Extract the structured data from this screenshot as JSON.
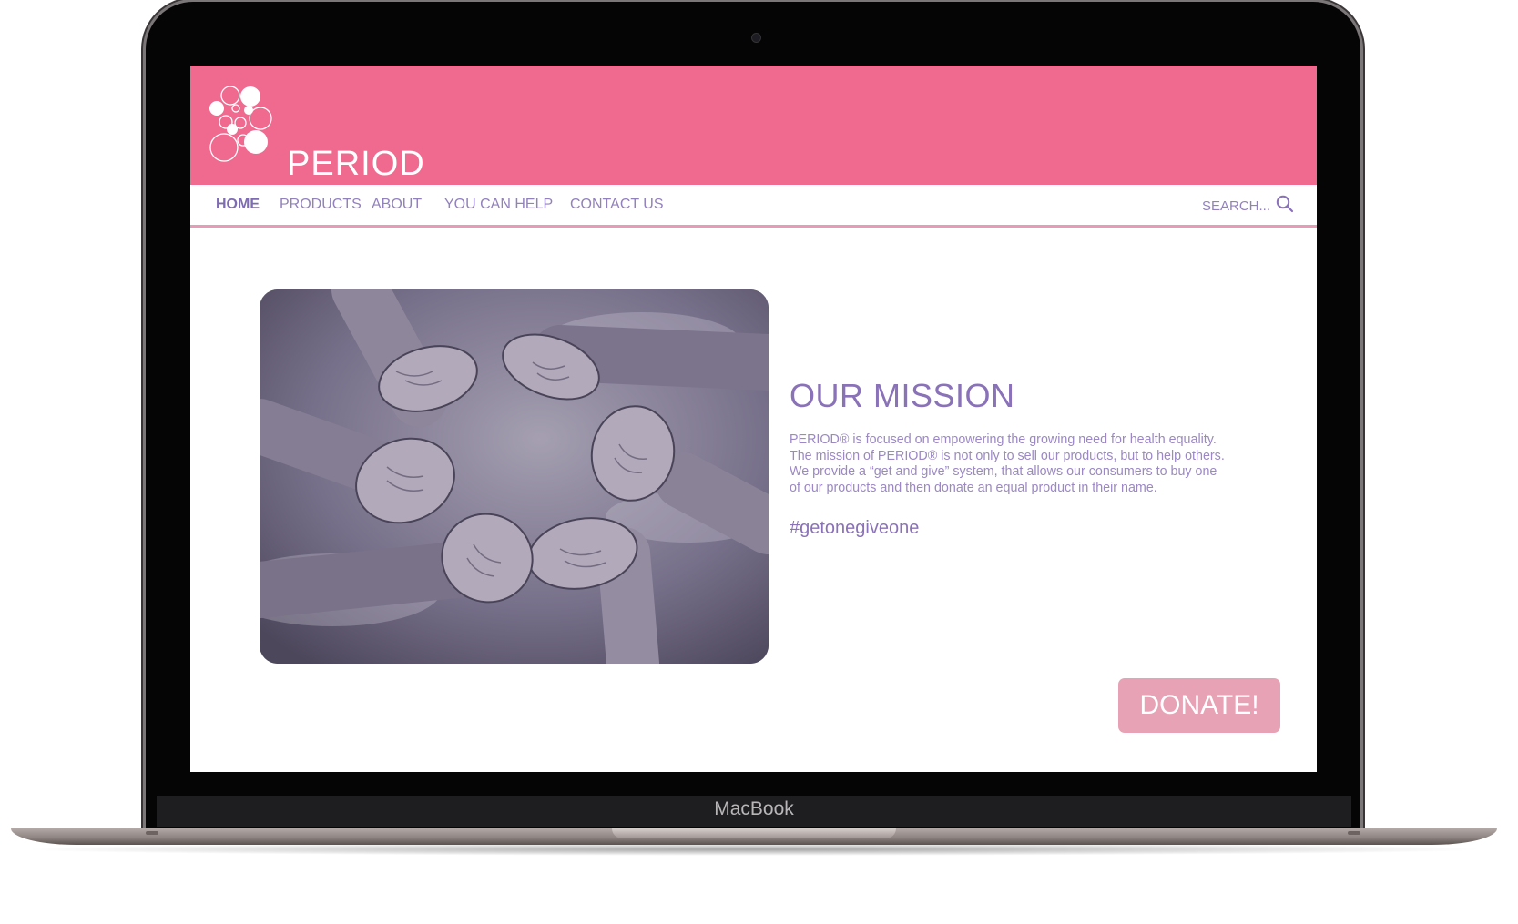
{
  "device": {
    "brand_label": "MacBook"
  },
  "site": {
    "logo_text": "PERIOD",
    "brand_color": "#f0698f",
    "accent_color": "#8a72b8"
  },
  "nav": {
    "items": [
      {
        "label": "HOME",
        "active": true
      },
      {
        "label": "PRODUCTS",
        "active": false
      },
      {
        "label": "ABOUT",
        "active": false
      },
      {
        "label": "YOU CAN HELP",
        "active": false
      },
      {
        "label": "CONTACT US",
        "active": false
      }
    ],
    "search_placeholder": "SEARCH...",
    "search_icon": "search-icon"
  },
  "main": {
    "image_icon": "hands-joined-photo",
    "mission_title": "OUR MISSION",
    "mission_lines": [
      "PERIOD® is focused on empowering the growing need for health equality.",
      "The mission of PERIOD® is not only to sell our products, but to help others.",
      "We provide a “get and give” system, that allows our consumers to buy one",
      "of our products and then donate an equal product in their name."
    ],
    "hashtag": "#getonegiveone",
    "donate_label": "DONATE!"
  }
}
